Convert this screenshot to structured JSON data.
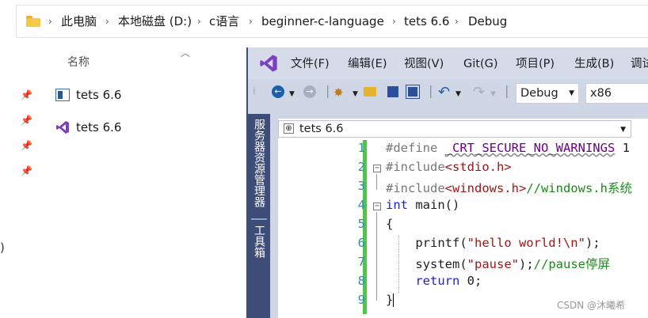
{
  "explorer": {
    "breadcrumb": [
      "此电脑",
      "本地磁盘 (D:)",
      "c语言",
      "beginner-c-language",
      "tets 6.6",
      "Debug"
    ],
    "column_header": "名称",
    "files": [
      {
        "name": "tets 6.6",
        "icon": "application-icon"
      },
      {
        "name": "tets 6.6",
        "icon": "visual-studio-solution-icon"
      }
    ],
    "edge_text": ")"
  },
  "vs": {
    "menu": [
      "文件(F)",
      "编辑(E)",
      "视图(V)",
      "Git(G)",
      "项目(P)",
      "生成(B)",
      "调试"
    ],
    "config": "Debug",
    "platform": "x86",
    "side_tabs": [
      "服务器资源管理器",
      "工具箱"
    ],
    "nav_scope": "tets 6.6",
    "line_numbers": [
      "1",
      "2",
      "3",
      "4",
      "5",
      "6",
      "7",
      "8",
      "9"
    ],
    "code": {
      "l1_directive": "#define ",
      "l1_macro": "_CRT_SECURE_NO_WARNINGS",
      "l1_value": " 1",
      "l2_directive": "#include",
      "l2_header": "<stdio.h>",
      "l3_directive": "#include",
      "l3_header": "<windows.h>",
      "l3_comment": "//windows.h系统",
      "l4_type": "int",
      "l4_rest": " main()",
      "l5": "{",
      "l6_call": "    printf(",
      "l6_str": "\"hello world!\\n\"",
      "l6_end": ");",
      "l7_call": "    system(",
      "l7_str": "\"pause\"",
      "l7_end": ");",
      "l7_comment": "//pause停屏",
      "l8_kw": "    return",
      "l8_rest": " 0;",
      "l9": "}"
    }
  },
  "watermark": "CSDN @沐曦希",
  "colors": {
    "accent": "#3d4d77",
    "change_bar": "#57c053",
    "keyword": "#1e1ee0",
    "string": "#a31515",
    "comment": "#1a8a1a"
  }
}
